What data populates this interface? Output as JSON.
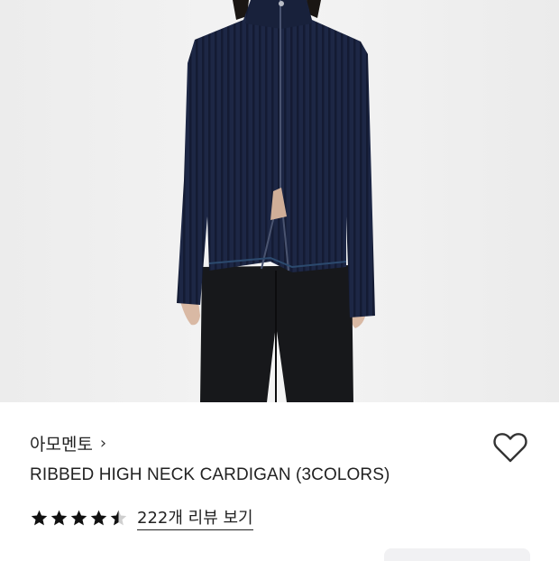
{
  "product": {
    "brand": "아모멘토",
    "brand_chevron": "›",
    "name": "RIBBED HIGH NECK CARDIGAN (3COLORS)",
    "rating": 4.5,
    "review_link": "222개 리뷰 보기"
  },
  "icons": {
    "heart": "heart-outline-icon",
    "star": "star-icon"
  },
  "colors": {
    "star": "#111111",
    "heart_stroke": "#333333",
    "garment": "#1c2540"
  }
}
